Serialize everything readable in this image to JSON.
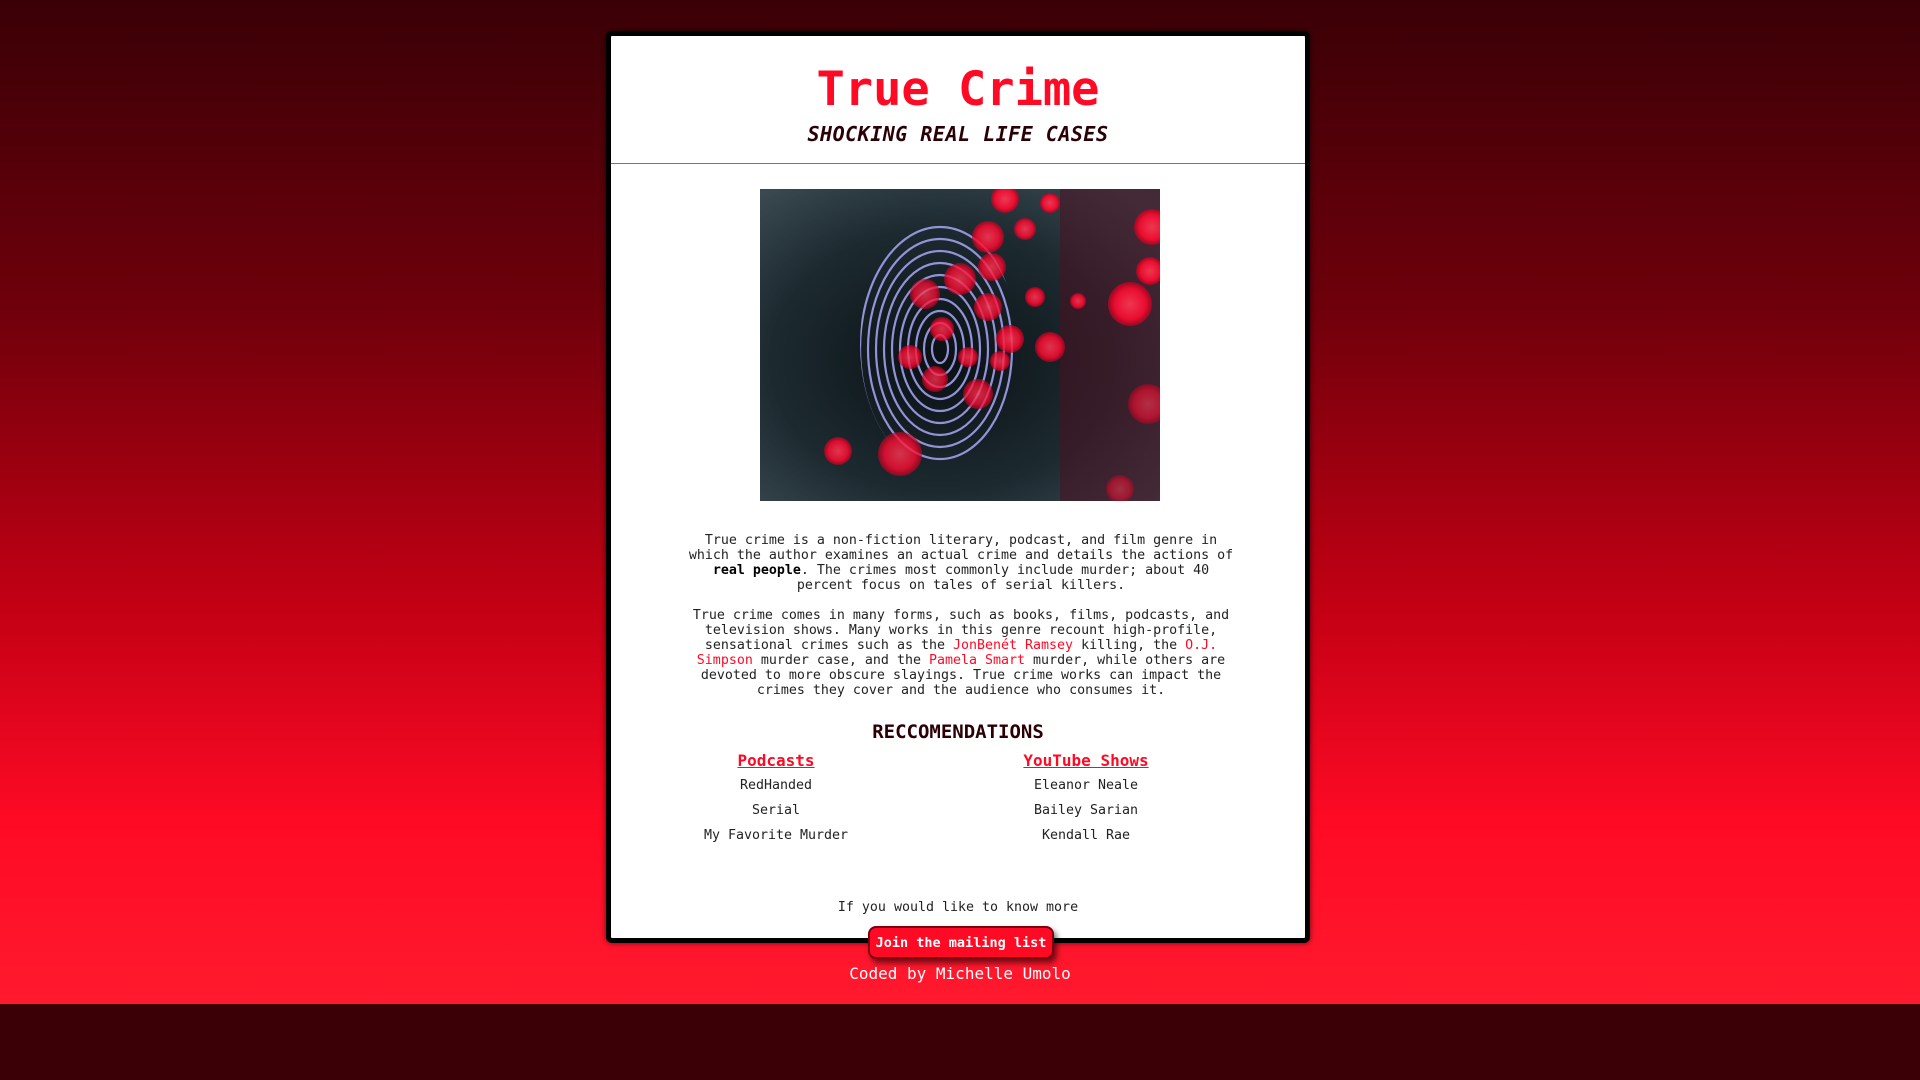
{
  "header": {
    "title": "True Crime",
    "subtitle": "SHOCKING REAL LIFE CASES"
  },
  "hero": {
    "icon": "fingerprint-icon"
  },
  "intro": {
    "p1_part1": "True crime is a non-fiction literary, podcast, and film genre in which the author examines an actual crime and details the actions of ",
    "p1_bold": "real people",
    "p1_part2": ". The crimes most commonly include murder; about 40 percent focus on tales of serial killers.",
    "p2_part1": "True crime comes in many forms, such as books, films, podcasts, and television shows. Many works in this genre recount high-profile, sensational crimes such as the ",
    "link_jonbenet": "JonBenét Ramsey",
    "p2_part2": " killing, the ",
    "link_oj": "O.J. Simpson",
    "p2_part3": " murder case, and the ",
    "link_pamela": "Pamela Smart",
    "p2_part4": " murder, while others are devoted to more obscure slayings. True crime works can impact the crimes they cover and the audience who consumes it."
  },
  "recommendations": {
    "title": "RECCOMENDATIONS",
    "podcasts": {
      "heading": "Podcasts",
      "items": [
        "RedHanded",
        "Serial",
        "My Favorite Murder"
      ]
    },
    "youtube": {
      "heading": "YouTube Shows",
      "items": [
        "Eleanor Neale",
        "Bailey Sarian",
        "Kendall Rae"
      ]
    }
  },
  "cta": {
    "prompt": "If you would like to know more",
    "button_label": "Join the mailing list"
  },
  "footer": {
    "credit": "Coded by Michelle Umolo"
  },
  "colors": {
    "accent": "#ff0a25",
    "dark": "#2a0006",
    "background_top": "#3a0006"
  }
}
